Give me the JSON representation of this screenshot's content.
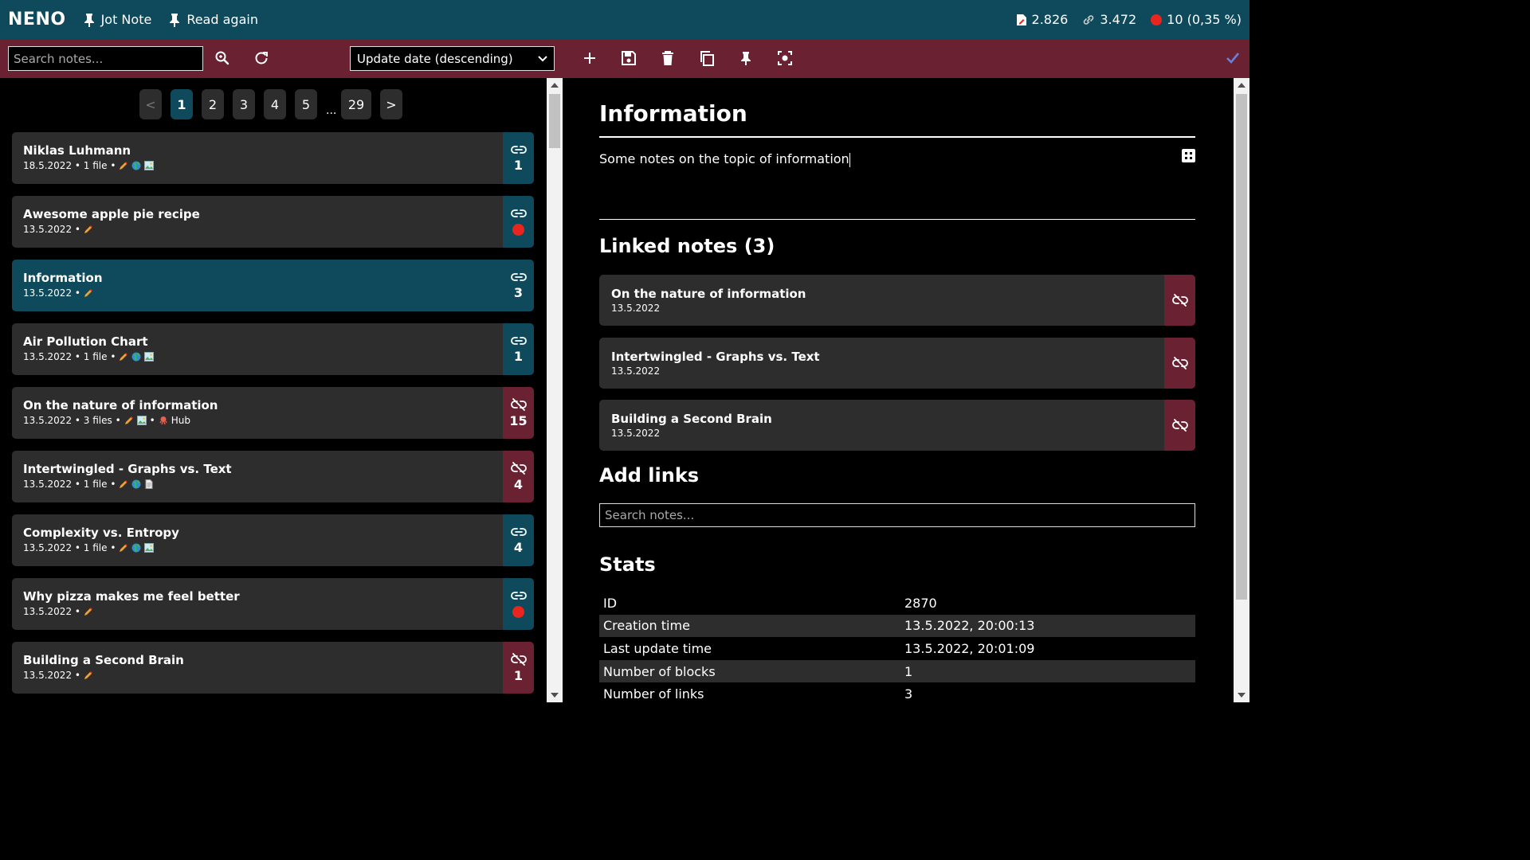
{
  "app": {
    "logo": "NENO",
    "links": [
      "Jot Note",
      "Read again"
    ],
    "stats": {
      "notes": "2.826",
      "links": "3.472",
      "unlinked": "10 (0,35 %)"
    }
  },
  "toolbar": {
    "search_placeholder": "Search notes...",
    "sort_selected": "Update date (descending)"
  },
  "pagination": {
    "prev": "<",
    "pages": [
      "1",
      "2",
      "3",
      "4",
      "5"
    ],
    "ellipsis": "...",
    "last": "29",
    "next": ">",
    "current": "1"
  },
  "notes": [
    {
      "title": "Niklas Luhmann",
      "meta": "18.5.2022 • 1 file •",
      "badges": [
        "pencil",
        "globe",
        "image"
      ],
      "link_state": "linked",
      "count": "1"
    },
    {
      "title": "Awesome apple pie recipe",
      "meta": "13.5.2022 •",
      "badges": [
        "pencil"
      ],
      "link_state": "linked",
      "count": ""
    },
    {
      "title": "Information",
      "meta": "13.5.2022 •",
      "badges": [
        "pencil"
      ],
      "link_state": "linked",
      "count": "3",
      "active": true
    },
    {
      "title": "Air Pollution Chart",
      "meta": "13.5.2022 • 1 file •",
      "badges": [
        "pencil",
        "globe",
        "image"
      ],
      "link_state": "linked",
      "count": "1"
    },
    {
      "title": "On the nature of information",
      "meta": "13.5.2022 • 3 files •",
      "badges": [
        "pencil",
        "image"
      ],
      "extra": "• ",
      "hub_label": "Hub",
      "link_state": "unlinked",
      "count": "15"
    },
    {
      "title": "Intertwingled - Graphs vs. Text",
      "meta": "13.5.2022 • 1 file •",
      "badges": [
        "pencil",
        "globe",
        "document"
      ],
      "link_state": "unlinked",
      "count": "4"
    },
    {
      "title": "Complexity vs. Entropy",
      "meta": "13.5.2022 • 1 file •",
      "badges": [
        "pencil",
        "globe",
        "image"
      ],
      "link_state": "linked",
      "count": "4"
    },
    {
      "title": "Why pizza makes me feel better",
      "meta": "13.5.2022 •",
      "badges": [
        "pencil"
      ],
      "link_state": "linked",
      "count": ""
    },
    {
      "title": "Building a Second Brain",
      "meta": "13.5.2022 •",
      "badges": [
        "pencil"
      ],
      "link_state": "unlinked",
      "count": "1"
    }
  ],
  "editor": {
    "title": "Information",
    "body": "Some notes on the topic of information",
    "linked_heading": "Linked notes (3)",
    "linked_notes": [
      {
        "title": "On the nature of information",
        "date": "13.5.2022"
      },
      {
        "title": "Intertwingled - Graphs vs. Text",
        "date": "13.5.2022"
      },
      {
        "title": "Building a Second Brain",
        "date": "13.5.2022"
      }
    ],
    "add_links_heading": "Add links",
    "add_links_placeholder": "Search notes...",
    "stats_heading": "Stats",
    "stats": [
      {
        "label": "ID",
        "value": "2870"
      },
      {
        "label": "Creation time",
        "value": "13.5.2022, 20:00:13"
      },
      {
        "label": "Last update time",
        "value": "13.5.2022, 20:01:09"
      },
      {
        "label": "Number of blocks",
        "value": "1"
      },
      {
        "label": "Number of links",
        "value": "3"
      }
    ]
  },
  "colors": {
    "header": "#0e4a5c",
    "toolbar": "#6a2233",
    "card": "#2d2d2d",
    "unlinked_dot": "#e8251f"
  }
}
